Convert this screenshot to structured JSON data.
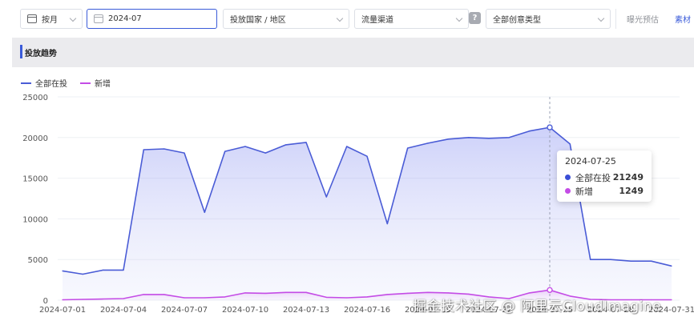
{
  "filters": {
    "granularity": "按月",
    "date": "2024-07",
    "country": "投放国家 / 地区",
    "channel": "流量渠道",
    "help": "?",
    "creative_type": "全部创意类型"
  },
  "tabs": [
    {
      "label": "曝光预估"
    },
    {
      "label": "素材"
    }
  ],
  "section": {
    "title": "投放趋势"
  },
  "watermark": "掘金技术社区 @ 阿里云CloudImagine",
  "chart_data": {
    "type": "area",
    "series_colors": {
      "all": "#4a5cd6",
      "new": "#c44ce6"
    },
    "legend": [
      {
        "name": "全部在投",
        "color": "#4a5cd6"
      },
      {
        "name": "新增",
        "color": "#c44ce6"
      }
    ],
    "ylim": [
      0,
      25000
    ],
    "yticks": [
      0,
      5000,
      10000,
      15000,
      20000,
      25000
    ],
    "x_tick_labels": [
      "2024-07-01",
      "2024-07-04",
      "2024-07-07",
      "2024-07-10",
      "2024-07-13",
      "2024-07-16",
      "2024-07-19",
      "2024-07-22",
      "2024-07-25",
      "2024-07-28",
      "2024-07-31"
    ],
    "x": [
      "2024-07-01",
      "2024-07-02",
      "2024-07-03",
      "2024-07-04",
      "2024-07-05",
      "2024-07-06",
      "2024-07-07",
      "2024-07-08",
      "2024-07-09",
      "2024-07-10",
      "2024-07-11",
      "2024-07-12",
      "2024-07-13",
      "2024-07-14",
      "2024-07-15",
      "2024-07-16",
      "2024-07-17",
      "2024-07-18",
      "2024-07-19",
      "2024-07-20",
      "2024-07-21",
      "2024-07-22",
      "2024-07-23",
      "2024-07-24",
      "2024-07-25",
      "2024-07-26",
      "2024-07-27",
      "2024-07-28",
      "2024-07-29",
      "2024-07-30",
      "2024-07-31"
    ],
    "series": [
      {
        "name": "全部在投",
        "key": "all",
        "values": [
          3600,
          3200,
          3700,
          3700,
          18500,
          18600,
          18100,
          10800,
          18300,
          18900,
          18100,
          19100,
          19400,
          12700,
          18900,
          17700,
          9400,
          18700,
          19300,
          19800,
          20000,
          19900,
          20000,
          20800,
          21249,
          19200,
          5000,
          5000,
          4800,
          4800,
          4200
        ]
      },
      {
        "name": "新增",
        "key": "new",
        "values": [
          50,
          100,
          150,
          200,
          700,
          700,
          300,
          300,
          400,
          900,
          850,
          950,
          950,
          350,
          300,
          400,
          700,
          850,
          950,
          900,
          750,
          400,
          200,
          900,
          1249,
          500,
          100,
          50,
          50,
          50,
          50
        ]
      }
    ],
    "tooltip": {
      "x": "2024-07-25",
      "rows": [
        {
          "name": "全部在投",
          "value": "21249",
          "color": "#3a4ed6"
        },
        {
          "name": "新增",
          "value": "1249",
          "color": "#c44ce6"
        }
      ]
    },
    "highlight_index": 24
  }
}
